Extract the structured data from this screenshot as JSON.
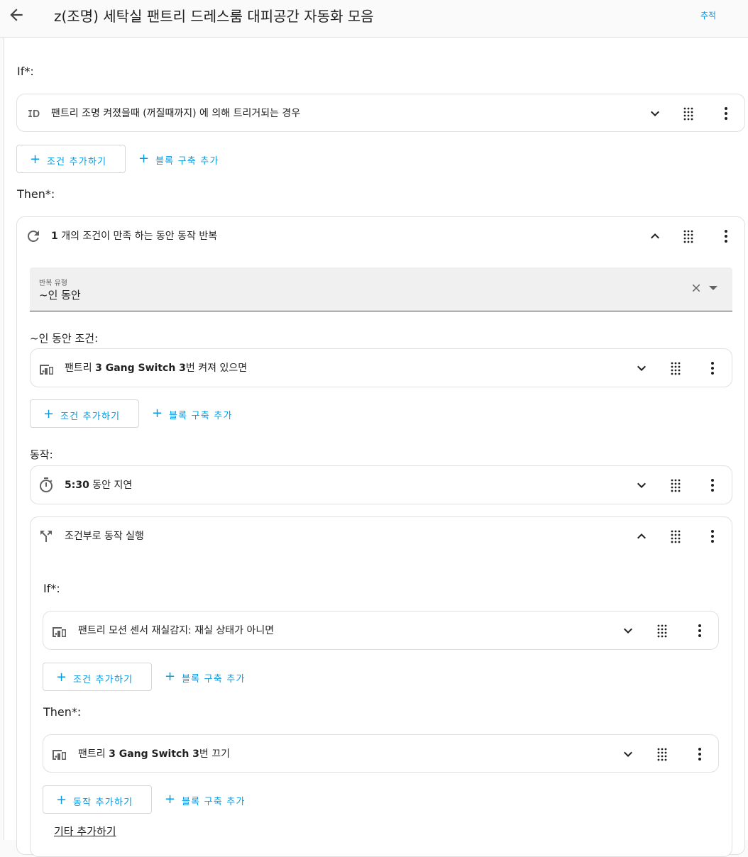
{
  "header": {
    "title": "z(조명) 세탁실 팬트리 드레스룸 대피공간 자동화 모음",
    "trace_label": "추적"
  },
  "root": {
    "if_label": "If*:",
    "trigger": {
      "icon": "id-icon",
      "text": "팬트리 조명 켜졌을때 (꺼질때까지) 에 의해 트리거되는 경우"
    },
    "add_condition_label": "조건 추가하기",
    "add_block_label": "블록 구축 추가",
    "then_label": "Then*:"
  },
  "repeat": {
    "icon": "repeat-icon",
    "count": "1",
    "text": " 개의 조건이 만족 하는 동안 동작 반복",
    "select_caption": "반복 유형",
    "select_value": "~인 동안",
    "while_label": "~인 동안 조건:",
    "condition": {
      "prefix": "팬트리 ",
      "entity": "3 Gang Switch 3",
      "suffix": "번 켜져 있으면"
    },
    "add_condition_label": "조건 추가하기",
    "add_block_label": "블록 구축 추가",
    "actions_label": "동작:",
    "delay": {
      "value": "5:30",
      "text": " 동안 지연"
    }
  },
  "choose": {
    "icon": "branch-icon",
    "text": "조건부로 동작 실행",
    "if_label": "If*:",
    "condition_text": "팬트리 모션 센서 재실감지: 재실 상태가 아니면",
    "add_condition_label": "조건 추가하기",
    "add_block_label": "블록 구축 추가",
    "then_label": "Then*:",
    "action": {
      "prefix": "팬트리 ",
      "entity": "3 Gang Switch 3",
      "suffix": "번 끄기"
    },
    "add_action_label": "동작 추가하기",
    "add_block_label_2": "블록 구축 추가",
    "other_label": "기타 추가하기"
  },
  "colors": {
    "accent": "#039be5",
    "border": "#e0e0e0",
    "select_bg": "#f0f0f0"
  }
}
